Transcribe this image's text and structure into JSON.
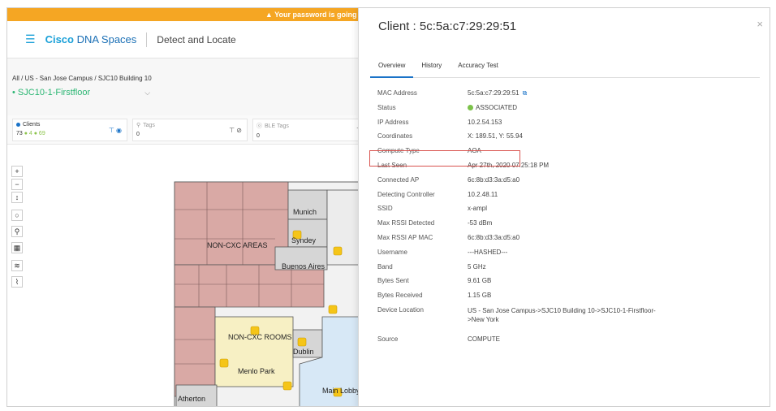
{
  "banner": {
    "text": "▲ Your password is going t"
  },
  "header": {
    "menu_icon": "hamburger-icon",
    "brand_bold": "Cisco",
    "brand_rest": " DNA Spaces",
    "app_title": "Detect and Locate"
  },
  "subhead": {
    "breadcrumb": "All / US - San Jose Campus / SJC10 Building 10",
    "floor": "SJC10-1-Firstfloor"
  },
  "filters": [
    {
      "label": "Clients",
      "count": "73",
      "badges": "● 4 ● 69"
    },
    {
      "label": "Tags",
      "count": "0"
    },
    {
      "label": "BLE Tags",
      "count": "0"
    }
  ],
  "map": {
    "labels": [
      "Munich",
      "Syndey",
      "NON-CXC AREAS",
      "Buenos Aires",
      "NON-CXC ROOMS",
      "Dublin",
      "Menlo Park",
      "Atherton",
      "Main Lobby"
    ],
    "tools": [
      "+",
      "−",
      "↕",
      "○",
      "⚲",
      "▦",
      "≋",
      "⌇"
    ]
  },
  "panel": {
    "title": "Client : 5c:5a:c7:29:29:51",
    "close_label": "×",
    "tabs": [
      "Overview",
      "History",
      "Accuracy Test"
    ],
    "rows": [
      {
        "k": "MAC Address",
        "v": "5c:5a:c7:29:29:51"
      },
      {
        "k": "Status",
        "v": "ASSOCIATED"
      },
      {
        "k": "IP Address",
        "v": "10.2.54.153"
      },
      {
        "k": "Coordinates",
        "v": "X: 189.51, Y: 55.94"
      },
      {
        "k": "Compute Type",
        "v": "AOA"
      },
      {
        "k": "Last Seen",
        "v": "Apr 27th, 2020 07:25:18 PM"
      },
      {
        "k": "Connected AP",
        "v": "6c:8b:d3:3a:d5:a0"
      },
      {
        "k": "Detecting Controller",
        "v": "10.2.48.11"
      },
      {
        "k": "SSID",
        "v": "x-ampl"
      },
      {
        "k": "Max RSSI Detected",
        "v": "-53 dBm"
      },
      {
        "k": "Max RSSI AP MAC",
        "v": "6c:8b:d3:3a:d5:a0"
      },
      {
        "k": "Username",
        "v": "---HASHED---"
      },
      {
        "k": "Band",
        "v": "5 GHz"
      },
      {
        "k": "Bytes Sent",
        "v": "9.61 GB"
      },
      {
        "k": "Bytes Received",
        "v": "1.15 GB"
      },
      {
        "k": "Device Location",
        "v": "US - San Jose Campus->SJC10 Building 10->SJC10-1-Firstfloor->New York"
      },
      {
        "k": "Source",
        "v": "COMPUTE"
      }
    ]
  }
}
